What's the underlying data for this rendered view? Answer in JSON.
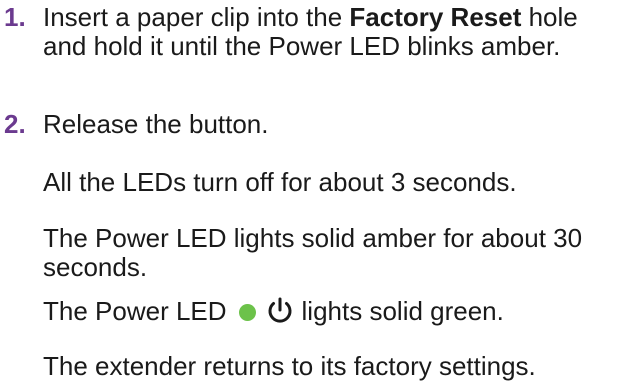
{
  "steps": [
    {
      "number": "1.",
      "text_before": "Insert a paper clip into the ",
      "bold": "Factory Reset",
      "text_after": " hole and hold it until the Power LED blinks amber."
    },
    {
      "number": "2.",
      "text": "Release the button."
    }
  ],
  "results": {
    "leds_off": "All the LEDs turn off for about 3 seconds.",
    "amber": "The Power LED lights solid amber for about 30 seconds.",
    "green_before": "The Power LED",
    "green_after": "lights solid green.",
    "factory": "The extender returns to its factory settings."
  },
  "colors": {
    "step_number": "#6b3a8f",
    "led_green": "#6cc24a",
    "text": "#1a1a1a"
  },
  "icons": {
    "led": "green-led-dot-icon",
    "power": "power-icon"
  }
}
